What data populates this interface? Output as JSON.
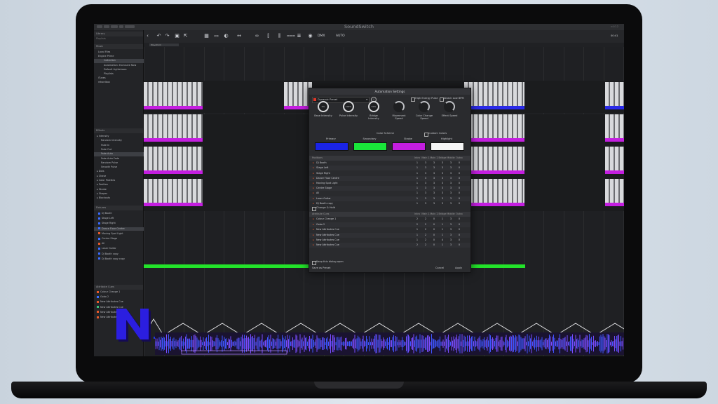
{
  "app": {
    "title": "SoundSwitch",
    "version": "v4.0.2"
  },
  "sidebar": {
    "library_header": "Library",
    "library_sub": "Playlists",
    "music_header": "Music",
    "music_items": [
      {
        "label": "Local Files",
        "sel": false
      },
      {
        "label": "Engine Prime",
        "sel": false
      },
      {
        "label": "Collection",
        "sel": true
      },
      {
        "label": "Automation: Exclusive Now",
        "sel": false
      },
      {
        "label": "Default Lightshows",
        "sel": false
      },
      {
        "label": "Playlists",
        "sel": false
      },
      {
        "label": "iTunes",
        "sel": false
      },
      {
        "label": "rekordbox",
        "sel": false
      }
    ],
    "effects_header": "Effects",
    "effect_items": [
      "Intensity",
      "Random Intensity",
      "Fade In",
      "Fade Out",
      "Fade Auto",
      "Fade Auto Fade",
      "Random Pulse",
      "Smooth Pulse",
      "Dots",
      "Chase",
      "Color Palettes",
      "Position",
      "Strobe",
      "Shapes",
      "Blackouts"
    ],
    "fixtures_header": "Fixtures",
    "fixture_items": [
      {
        "label": "DJ Booth",
        "color": "#3a6cff"
      },
      {
        "label": "Stage Left",
        "color": "#3a6cff"
      },
      {
        "label": "Stage Right",
        "color": "#3a6cff"
      },
      {
        "label": "Dance Floor Centre",
        "color": "#3a6cff"
      },
      {
        "label": "Moving Spot Light",
        "color": "#e85a2a"
      },
      {
        "label": "Centre Stage",
        "color": "#3a6cff"
      },
      {
        "label": "All",
        "color": "#e85a2a"
      },
      {
        "label": "Laser Guitar",
        "color": "#3a6cff"
      },
      {
        "label": "DJ Booth copy",
        "color": "#3a6cff"
      },
      {
        "label": "DJ Booth copy copy",
        "color": "#3a6cff"
      }
    ],
    "attribute_header": "Attribute Cues",
    "attribute_items": [
      {
        "label": "Colour Change 1",
        "color": "#e85a2a"
      },
      {
        "label": "Gobo 2",
        "color": "#3a6cff"
      },
      {
        "label": "New Attributes Cue",
        "color": "#e85a2a"
      },
      {
        "label": "New Attributes Cue",
        "color": "#3ac27a"
      },
      {
        "label": "New Attributes Cue",
        "color": "#e85a2a"
      },
      {
        "label": "New Attributes Cue",
        "color": "#e85a2a"
      }
    ]
  },
  "toolbar": {
    "dmx_label": "DMX",
    "auto_label": "AUTO",
    "bpm": "00:41"
  },
  "ruler": {
    "tab_label": "Waveform"
  },
  "dialog": {
    "title": "Automation Settings",
    "preset": "Dynamic Preset",
    "option1": "High Energy Pulse",
    "option2": "Attack Low BPM",
    "knobs": [
      {
        "label": "Base Intensity",
        "value": "0%"
      },
      {
        "label": "Pulse Intensity",
        "value": "100%"
      },
      {
        "label": "Bridge Intensity",
        "value": "50%"
      },
      {
        "label": "Movement Speed",
        "value": ""
      },
      {
        "label": "Color Change Speed",
        "value": ""
      },
      {
        "label": "Effect Speed",
        "value": ""
      }
    ],
    "color_scheme_label": "Color Scheme",
    "custom_colors_label": "Custom Colors",
    "colors": [
      {
        "label": "Primary",
        "hex": "#1a24e6"
      },
      {
        "label": "Secondary",
        "hex": "#19e63a"
      },
      {
        "label": "Strobe",
        "hex": "#c41ee0"
      },
      {
        "label": "Highlight",
        "hex": "#f5f5f5"
      }
    ],
    "fixture_table": {
      "headers": [
        "Positions",
        "Intro",
        "Main 1",
        "Main 2",
        "Bridge",
        "Middle",
        "Outro"
      ],
      "rows": [
        {
          "name": "DJ Booth",
          "vals": [
            "1",
            "3",
            "3",
            "3",
            "3",
            "0"
          ]
        },
        {
          "name": "Stage Left",
          "vals": [
            "1",
            "3",
            "3",
            "3",
            "3",
            "0"
          ]
        },
        {
          "name": "Stage Right",
          "vals": [
            "1",
            "3",
            "3",
            "3",
            "3",
            "0"
          ]
        },
        {
          "name": "Dance Floor Centre",
          "vals": [
            "1",
            "3",
            "3",
            "3",
            "3",
            "0"
          ]
        },
        {
          "name": "Moving Spot Light",
          "vals": [
            "1",
            "3",
            "3",
            "3",
            "3",
            "0"
          ]
        },
        {
          "name": "Centre Stage",
          "vals": [
            "1",
            "3",
            "3",
            "3",
            "3",
            "0"
          ]
        },
        {
          "name": "All",
          "vals": [
            "1",
            "3",
            "3",
            "3",
            "3",
            "0"
          ]
        },
        {
          "name": "Laser Guitar",
          "vals": [
            "1",
            "3",
            "3",
            "3",
            "3",
            "0"
          ]
        },
        {
          "name": "DJ Booth copy",
          "vals": [
            "1",
            "3",
            "3",
            "3",
            "3",
            "0"
          ]
        }
      ]
    },
    "change_label": "Change & Hold",
    "attribute_table": {
      "headers": [
        "Attribute Cues",
        "Intro",
        "Main 1",
        "Main 2",
        "Bridge",
        "Middle",
        "Outro"
      ],
      "rows": [
        {
          "name": "Colour Change 1",
          "vals": [
            "2",
            "2",
            "0",
            "1",
            "3",
            "0"
          ]
        },
        {
          "name": "Gobo 2",
          "vals": [
            "2",
            "2",
            "0",
            "1",
            "3",
            "0"
          ]
        },
        {
          "name": "New Attributes Cue",
          "vals": [
            "1",
            "2",
            "0",
            "1",
            "3",
            "0"
          ]
        },
        {
          "name": "New Attributes Cue",
          "vals": [
            "1",
            "2",
            "0",
            "1",
            "3",
            "0"
          ]
        },
        {
          "name": "New Attributes Cue",
          "vals": [
            "1",
            "2",
            "0",
            "4",
            "3",
            "0"
          ]
        },
        {
          "name": "New Attributes Cue",
          "vals": [
            "2",
            "2",
            "0",
            "1",
            "3",
            "0"
          ]
        }
      ]
    },
    "keep_open_label": "Keep this dialog open",
    "save_preset_label": "Save as Preset",
    "cancel_label": "Cancel",
    "apply_label": "Apply"
  },
  "logo": {
    "letter": "N",
    "color": "#2b1ee0"
  }
}
